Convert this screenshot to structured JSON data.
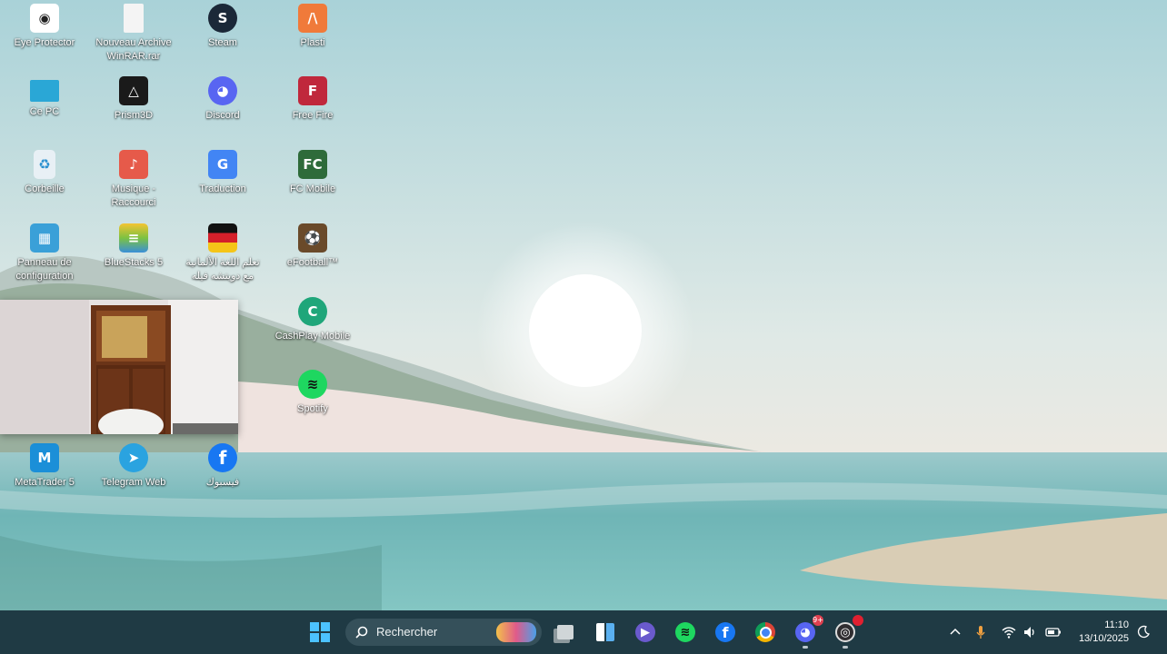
{
  "desktop": {
    "icons": [
      {
        "label": "Eye Protector",
        "icon": "eye-protector-icon",
        "color": "#ffffff"
      },
      {
        "label": "Nouveau Archive WinRAR.rar",
        "icon": "file-icon",
        "color": "#f2f2f2"
      },
      {
        "label": "Steam",
        "icon": "steam-icon",
        "color": "#1b2838"
      },
      {
        "label": "Plasti",
        "icon": "plasti-icon",
        "color": "#f07a3a"
      },
      {
        "label": "Ce PC",
        "icon": "monitor-icon",
        "color": "#2aa7d6"
      },
      {
        "label": "Prism3D",
        "icon": "prism3d-icon",
        "color": "#1a1a1a"
      },
      {
        "label": "Discord",
        "icon": "discord-icon",
        "color": "#5865f2"
      },
      {
        "label": "Free Fire",
        "icon": "free-fire-icon",
        "color": "#c0283c"
      },
      {
        "label": "Corbeille",
        "icon": "recycle-bin-icon",
        "color": "#e8f0f5"
      },
      {
        "label": "Musique - Raccourci",
        "icon": "folder-music-icon",
        "color": "#e65a4a"
      },
      {
        "label": "Traduction",
        "icon": "google-translate-icon",
        "color": "#4285f4"
      },
      {
        "label": "FC Mobile",
        "icon": "fc-mobile-icon",
        "color": "#2e6b3a"
      },
      {
        "label": "Panneau de configuration",
        "icon": "control-panel-icon",
        "color": "#3aa0d8"
      },
      {
        "label": "BlueStacks 5",
        "icon": "bluestacks-icon",
        "color": "#7cc241"
      },
      {
        "label": "تعلم اللغة الألمانية مع دويتشه فيله",
        "icon": "german-flag-icon",
        "color": "#d4202a"
      },
      {
        "label": "eFootball™",
        "icon": "efootball-icon",
        "color": "#6a4a2a"
      },
      {
        "label": "CashPlay Mobile",
        "icon": "cashplay-icon",
        "color": "#1fa67a"
      },
      {
        "label": "Spotify",
        "icon": "spotify-icon",
        "color": "#1ed760"
      },
      {
        "label": "MetaTrader 5",
        "icon": "metatrader-icon",
        "color": "#1b8fd8"
      },
      {
        "label": "Telegram Web",
        "icon": "telegram-icon",
        "color": "#2aa3e0"
      },
      {
        "label": "فيسبوك",
        "icon": "facebook-icon",
        "color": "#1877f2"
      }
    ]
  },
  "taskbar": {
    "search_placeholder": "Rechercher",
    "apps": [
      {
        "name": "task-view-icon",
        "color": "#9aa4a8",
        "running": false
      },
      {
        "name": "widgets-icon",
        "color": "#ffffff",
        "running": false
      },
      {
        "name": "zoom-icon",
        "color": "#6a5acd",
        "running": false
      },
      {
        "name": "spotify-icon",
        "color": "#1ed760",
        "running": false
      },
      {
        "name": "facebook-icon",
        "color": "#1877f2",
        "running": false
      },
      {
        "name": "chrome-icon",
        "color": "#db4437",
        "running": false
      },
      {
        "name": "discord-icon",
        "color": "#5865f2",
        "running": true,
        "badge": "9+"
      },
      {
        "name": "obs-icon",
        "color": "#302e31",
        "running": true,
        "badge": "•"
      }
    ],
    "clock": {
      "time": "11:10",
      "date": "13/10/2025"
    }
  }
}
